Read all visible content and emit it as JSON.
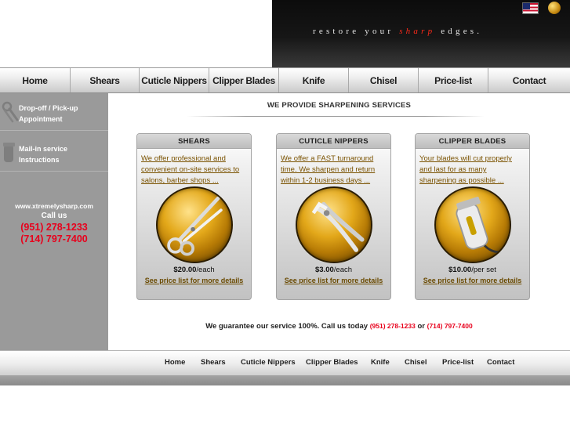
{
  "header": {
    "tagline_pre": "restore your",
    "tagline_highlight": "sharp",
    "tagline_post": "edges."
  },
  "nav": {
    "items": [
      "Home",
      "Shears",
      "Cuticle Nippers",
      "Clipper Blades",
      "Knife",
      "Chisel",
      "Price-list",
      "Contact"
    ]
  },
  "sidebar": {
    "items": [
      {
        "label_line1": "Drop-off / Pick-up",
        "label_line2": "Appointment"
      },
      {
        "label_line1": "Mail-in service",
        "label_line2": "Instructions"
      }
    ],
    "website": "www.xtremelysharp.com",
    "call_us": "Call us",
    "phone1": "(951) 278-1233",
    "phone2": "(714) 797-7400"
  },
  "main": {
    "title": "WE PROVIDE SHARPENING SERVICES",
    "cards": [
      {
        "heading": "SHEARS",
        "desc1": "We offer professional and",
        "desc2": "convenient on-site services to",
        "desc3": "salons, barber shops ...",
        "price": "$20.00",
        "unit": "/each",
        "link": "See price list for more details",
        "icon": "shears-icon"
      },
      {
        "heading": "CUTICLE NIPPERS",
        "desc1": "We offer a FAST turnaround",
        "desc2": "time. We sharpen and return",
        "desc3": "within 1-2 business days ...",
        "price": "$3.00",
        "unit": "/each",
        "link": "See price list for more details",
        "icon": "cuticle-nipper-icon"
      },
      {
        "heading": "CLIPPER  BLADES",
        "desc1": "Your blades will cut properly",
        "desc2": "and last for as many",
        "desc3": "sharpening as possible ...",
        "price": "$10.00",
        "unit": "/per set",
        "link": "See price list for more details",
        "icon": "hair-clipper-icon"
      }
    ],
    "guarantee_text": "We guarantee our service 100%. Call us today",
    "guarantee_phone1": "(951) 278-1233",
    "guarantee_or": "or",
    "guarantee_phone2": "(714) 797-7400"
  },
  "footer": {
    "links": [
      "Home",
      "Shears",
      "Cuticle Nippers",
      "Clipper Blades",
      "Knife",
      "Chisel",
      "Price-list",
      "Contact"
    ]
  },
  "colors": {
    "accent_red": "#e8001c",
    "link_brown": "#7a5200",
    "sidebar_gray": "#9a9a9a",
    "banner_black": "#0c0c0c"
  }
}
